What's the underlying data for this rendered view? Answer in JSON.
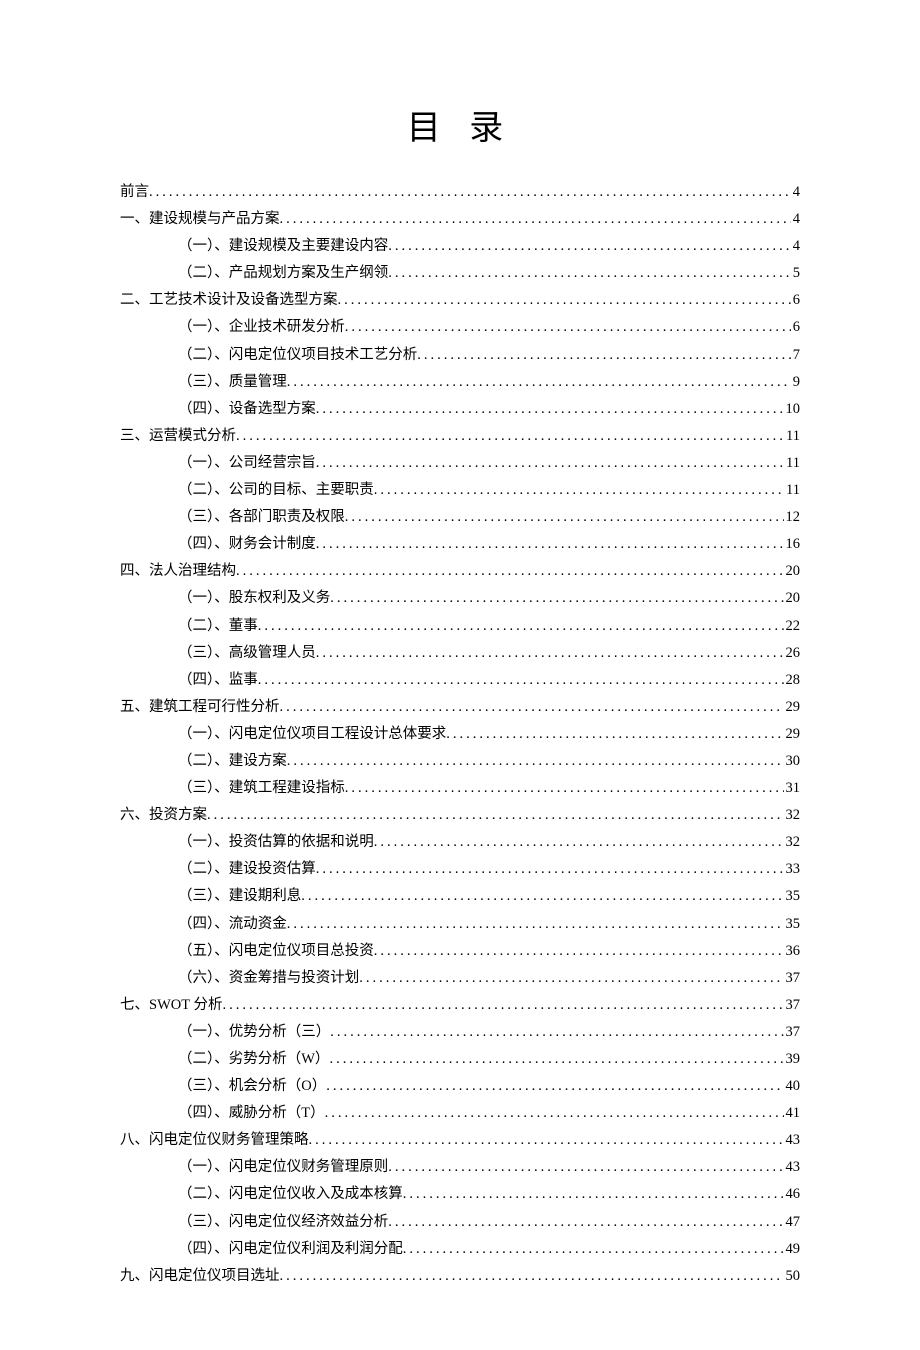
{
  "title": "目 录",
  "entries": [
    {
      "label": "前言",
      "page": "4",
      "sub": false
    },
    {
      "label": "一、建设规模与产品方案",
      "page": "4",
      "sub": false
    },
    {
      "label": "（一）、建设规模及主要建设内容",
      "page": "4",
      "sub": true
    },
    {
      "label": "（二）、产品规划方案及生产纲领",
      "page": "5",
      "sub": true
    },
    {
      "label": "二、工艺技术设计及设备选型方案",
      "page": "6",
      "sub": false
    },
    {
      "label": "（一）、企业技术研发分析",
      "page": "6",
      "sub": true
    },
    {
      "label": "（二）、闪电定位仪项目技术工艺分析",
      "page": "7",
      "sub": true
    },
    {
      "label": "（三）、质量管理",
      "page": "9",
      "sub": true
    },
    {
      "label": "（四）、设备选型方案",
      "page": "10",
      "sub": true
    },
    {
      "label": "三、运营模式分析",
      "page": "11",
      "sub": false
    },
    {
      "label": "（一）、公司经营宗旨",
      "page": "11",
      "sub": true
    },
    {
      "label": "（二）、公司的目标、主要职责",
      "page": "11",
      "sub": true
    },
    {
      "label": "（三）、各部门职责及权限",
      "page": "12",
      "sub": true
    },
    {
      "label": "（四）、财务会计制度",
      "page": "16",
      "sub": true
    },
    {
      "label": "四、法人治理结构",
      "page": "20",
      "sub": false
    },
    {
      "label": "（一）、股东权利及义务",
      "page": "20",
      "sub": true
    },
    {
      "label": "（二）、董事",
      "page": "22",
      "sub": true
    },
    {
      "label": "（三）、高级管理人员",
      "page": "26",
      "sub": true
    },
    {
      "label": "（四）、监事",
      "page": "28",
      "sub": true
    },
    {
      "label": "五、建筑工程可行性分析",
      "page": "29",
      "sub": false
    },
    {
      "label": "（一）、闪电定位仪项目工程设计总体要求",
      "page": "29",
      "sub": true
    },
    {
      "label": "（二）、建设方案",
      "page": "30",
      "sub": true
    },
    {
      "label": "（三）、建筑工程建设指标",
      "page": "31",
      "sub": true
    },
    {
      "label": "六、投资方案",
      "page": "32",
      "sub": false
    },
    {
      "label": "（一）、投资估算的依据和说明",
      "page": "32",
      "sub": true
    },
    {
      "label": "（二）、建设投资估算",
      "page": "33",
      "sub": true
    },
    {
      "label": "（三）、建设期利息",
      "page": "35",
      "sub": true
    },
    {
      "label": "（四）、流动资金",
      "page": "35",
      "sub": true
    },
    {
      "label": "（五）、闪电定位仪项目总投资",
      "page": "36",
      "sub": true
    },
    {
      "label": "（六）、资金筹措与投资计划",
      "page": "37",
      "sub": true
    },
    {
      "label": "七、SWOT 分析",
      "page": "37",
      "sub": false
    },
    {
      "label": "（一）、优势分析（三）",
      "page": "37",
      "sub": true
    },
    {
      "label": "（二）、劣势分析（W）",
      "page": "39",
      "sub": true
    },
    {
      "label": "（三）、机会分析（O）",
      "page": "40",
      "sub": true
    },
    {
      "label": "（四）、威胁分析（T）",
      "page": "41",
      "sub": true
    },
    {
      "label": "八、闪电定位仪财务管理策略",
      "page": "43",
      "sub": false
    },
    {
      "label": "（一）、闪电定位仪财务管理原则",
      "page": "43",
      "sub": true
    },
    {
      "label": "（二）、闪电定位仪收入及成本核算",
      "page": "46",
      "sub": true
    },
    {
      "label": "（三）、闪电定位仪经济效益分析",
      "page": "47",
      "sub": true
    },
    {
      "label": "（四）、闪电定位仪利润及利润分配",
      "page": "49",
      "sub": true
    },
    {
      "label": "九、闪电定位仪项目选址",
      "page": "50",
      "sub": false
    }
  ]
}
